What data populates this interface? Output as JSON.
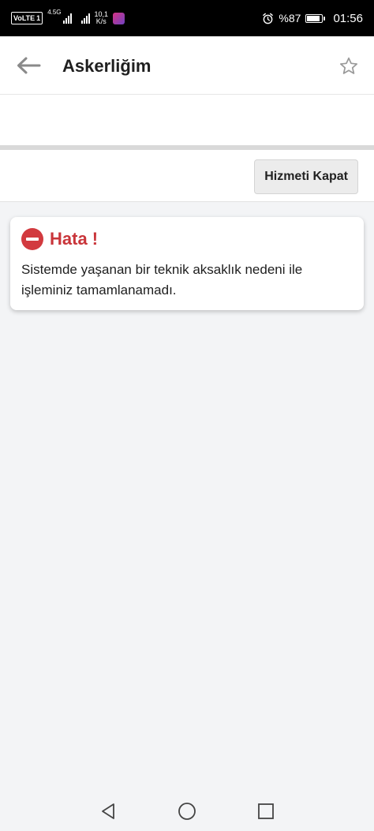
{
  "status_bar": {
    "volte": "VoLTE",
    "sim": "1",
    "network_gen": "4.5G",
    "speed_value": "10,1",
    "speed_unit": "K/s",
    "battery_percent": "%87",
    "battery_level": 0.87,
    "time": "01:56",
    "icons": [
      "volte-icon",
      "signal-icon",
      "signal-icon",
      "app-notification-icon",
      "alarm-icon",
      "battery-icon"
    ]
  },
  "app_bar": {
    "title": "Askerliğim",
    "back_icon": "arrow-left-icon",
    "favorite_icon": "star-outline-icon"
  },
  "service_bar": {
    "close_label": "Hizmeti Kapat"
  },
  "error": {
    "icon": "no-entry-icon",
    "title": "Hata !",
    "message": "Sistemde yaşanan bir teknik aksaklık nedeni ile işleminiz tamamlanamadı.",
    "color": "#c9353a"
  },
  "nav_bar": {
    "icons": [
      "back-triangle-icon",
      "home-circle-icon",
      "recents-square-icon"
    ]
  }
}
